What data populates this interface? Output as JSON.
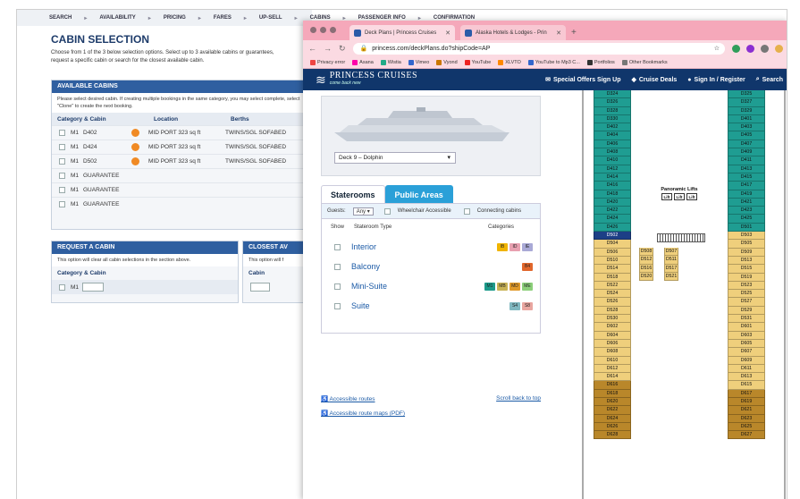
{
  "booking": {
    "crumbs": [
      "SEARCH",
      "AVAILABILITY",
      "PRICING",
      "FARES",
      "UP-SELL",
      "CABINS",
      "PASSENGER INFO",
      "CONFIRMATION"
    ],
    "title": "CABIN SELECTION",
    "desc": "Choose from 1 of the 3 below selection options. Select up to 3 available cabins or guarantees, request a specific cabin or search for the closest available cabin.",
    "available": {
      "head": "AVAILABLE CABINS",
      "note": "Please select desired cabin. If creating multiple bookings in the same category, you may select complete, select \"Clone\" to create the next booking.",
      "cols": [
        "Category & Cabin",
        "Location",
        "Berths"
      ],
      "rows": [
        {
          "cat": "M1",
          "cabin": "D402",
          "loc": "MID PORT 323 sq ft",
          "berths": "TWINS/SGL SOFABED"
        },
        {
          "cat": "M1",
          "cabin": "D424",
          "loc": "MID PORT 323 sq ft",
          "berths": "TWINS/SGL SOFABED"
        },
        {
          "cat": "M1",
          "cabin": "D502",
          "loc": "MID PORT 323 sq ft",
          "berths": "TWINS/SGL SOFABED"
        },
        {
          "cat": "M1",
          "cabin": "GUARANTEE"
        },
        {
          "cat": "M1",
          "cabin": "GUARANTEE"
        },
        {
          "cat": "M1",
          "cabin": "GUARANTEE"
        }
      ]
    },
    "request": {
      "head": "REQUEST A CABIN",
      "note": "This option will clear all cabin selections in the section above.",
      "label": "Category & Cabin",
      "cat": "M1"
    },
    "closest": {
      "head": "CLOSEST AV",
      "note": "This option will f",
      "label": "Cabin"
    }
  },
  "browser": {
    "tabs": [
      {
        "label": "Deck Plans | Princess Cruises"
      },
      {
        "label": "Alaska Hotels & Lodges - Prin"
      }
    ],
    "url": "princess.com/deckPlans.do?shipCode=AP",
    "bookmarks": [
      "Privacy error",
      "Asana",
      "Wistia",
      "Vimeo",
      "Vyond",
      "YouTube",
      "XLVTO",
      "YouTube to Mp3 C...",
      "Portfolios",
      "Other Bookmarks"
    ]
  },
  "site": {
    "logo_main": "PRINCESS CRUISES",
    "logo_sub": "come back new",
    "nav": [
      "Special Offers Sign Up",
      "Cruise Deals",
      "Sign In / Register",
      "Search"
    ],
    "deck_select": "Deck 9 – Dolphin",
    "tabs": {
      "staterooms": "Staterooms",
      "public": "Public Areas"
    },
    "guests_label": "Guests:",
    "guests_value": "Any",
    "wheelchair": "Wheelchair Accessible",
    "connecting": "Connecting cabins",
    "col_show": "Show",
    "col_type": "Stateroom Type",
    "col_categories": "Categories",
    "types": [
      {
        "name": "Interior",
        "badges": [
          "IB",
          "ID",
          "IE"
        ]
      },
      {
        "name": "Balcony",
        "badges": [
          "B4"
        ]
      },
      {
        "name": "Mini-Suite",
        "badges": [
          "M1",
          "MB",
          "MD",
          "ME"
        ]
      },
      {
        "name": "Suite",
        "badges": [
          "S4",
          "S8"
        ]
      }
    ],
    "links": {
      "accessible": "Accessible routes",
      "scroll": "Scroll back to top",
      "pdf": "Accessible route maps (PDF)"
    }
  },
  "plan": {
    "lifts_label": "Panoramic Lifts",
    "lift": "Lift",
    "left_col": [
      "D324",
      "D326",
      "D328",
      "D330",
      "D402",
      "D404",
      "D406",
      "D408",
      "D410",
      "D412",
      "D414",
      "D416",
      "D418",
      "D420",
      "D422",
      "D424",
      "D426",
      "D502",
      "D504",
      "D506",
      "D510",
      "D514",
      "D518",
      "D522",
      "D524",
      "D526",
      "D528",
      "D530",
      "D602",
      "D604",
      "D606",
      "D608",
      "D610",
      "D612",
      "D614",
      "D616",
      "D618",
      "D620",
      "D622",
      "D624",
      "D626",
      "D628"
    ],
    "right_col": [
      "D325",
      "D327",
      "D329",
      "D401",
      "D403",
      "D405",
      "D407",
      "D409",
      "D411",
      "D413",
      "D415",
      "D417",
      "D419",
      "D421",
      "D423",
      "D425",
      "D501",
      "D503",
      "D505",
      "D509",
      "D513",
      "D515",
      "D519",
      "D523",
      "D525",
      "D527",
      "D529",
      "D531",
      "D601",
      "D603",
      "D605",
      "D607",
      "D609",
      "D611",
      "D613",
      "D615",
      "D617",
      "D619",
      "D621",
      "D623",
      "D625",
      "D627"
    ],
    "mid_left": [
      "D508",
      "D512",
      "D516",
      "D520"
    ],
    "mid_right": [
      "D507",
      "D511",
      "D517",
      "D521"
    ],
    "selected": "D502"
  }
}
